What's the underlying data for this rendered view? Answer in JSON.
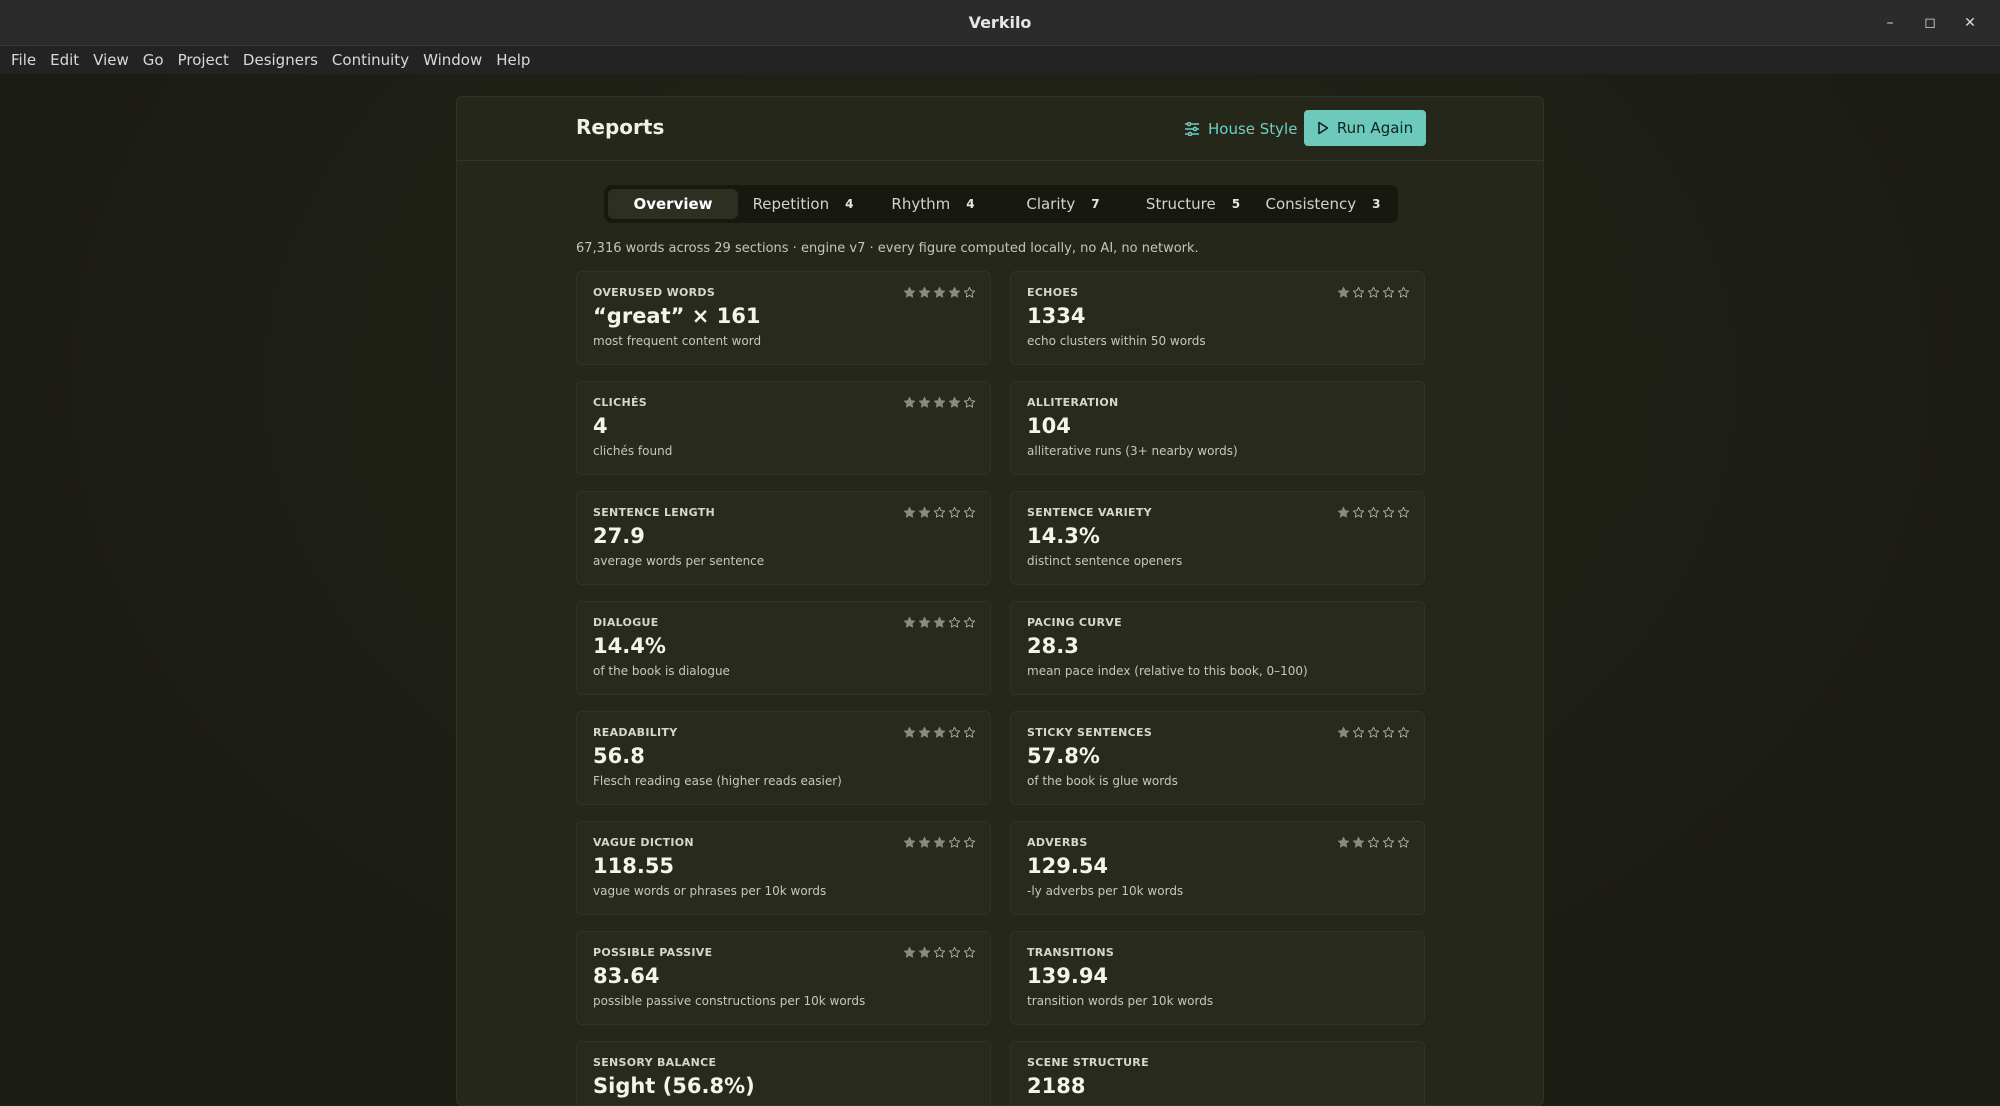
{
  "window": {
    "title": "Verkilo",
    "minimize": "–",
    "maximize": "◻",
    "close": "✕"
  },
  "menu": [
    "File",
    "Edit",
    "View",
    "Go",
    "Project",
    "Designers",
    "Continuity",
    "Window",
    "Help"
  ],
  "panel": {
    "title": "Reports",
    "house_style_label": "House Style",
    "run_again_label": "Run Again",
    "accent": "#6cc9bc"
  },
  "tabs": [
    {
      "label": "Overview",
      "count": "",
      "active": true
    },
    {
      "label": "Repetition",
      "count": "4",
      "active": false
    },
    {
      "label": "Rhythm",
      "count": "4",
      "active": false
    },
    {
      "label": "Clarity",
      "count": "7",
      "active": false
    },
    {
      "label": "Structure",
      "count": "5",
      "active": false
    },
    {
      "label": "Consistency",
      "count": "3",
      "active": false
    }
  ],
  "summary": "67,316 words across 29 sections · engine v7 · every figure computed locally, no AI, no network.",
  "cards": [
    {
      "label": "OVERUSED WORDS",
      "value": "“great” × 161",
      "desc": "most frequent content word",
      "rating": 4
    },
    {
      "label": "ECHOES",
      "value": "1334",
      "desc": "echo clusters within 50 words",
      "rating": 1
    },
    {
      "label": "CLICHÉS",
      "value": "4",
      "desc": "clichés found",
      "rating": 4
    },
    {
      "label": "ALLITERATION",
      "value": "104",
      "desc": "alliterative runs (3+ nearby words)",
      "rating": null
    },
    {
      "label": "SENTENCE LENGTH",
      "value": "27.9",
      "desc": "average words per sentence",
      "rating": 2
    },
    {
      "label": "SENTENCE VARIETY",
      "value": "14.3%",
      "desc": "distinct sentence openers",
      "rating": 1
    },
    {
      "label": "DIALOGUE",
      "value": "14.4%",
      "desc": "of the book is dialogue",
      "rating": 3
    },
    {
      "label": "PACING CURVE",
      "value": "28.3",
      "desc": "mean pace index (relative to this book, 0–100)",
      "rating": null
    },
    {
      "label": "READABILITY",
      "value": "56.8",
      "desc": "Flesch reading ease (higher reads easier)",
      "rating": 3
    },
    {
      "label": "STICKY SENTENCES",
      "value": "57.8%",
      "desc": "of the book is glue words",
      "rating": 1
    },
    {
      "label": "VAGUE DICTION",
      "value": "118.55",
      "desc": "vague words or phrases per 10k words",
      "rating": 3
    },
    {
      "label": "ADVERBS",
      "value": "129.54",
      "desc": "-ly adverbs per 10k words",
      "rating": 2
    },
    {
      "label": "POSSIBLE PASSIVE",
      "value": "83.64",
      "desc": "possible passive constructions per 10k words",
      "rating": 2
    },
    {
      "label": "TRANSITIONS",
      "value": "139.94",
      "desc": "transition words per 10k words",
      "rating": null
    },
    {
      "label": "SENSORY BALANCE",
      "value": "Sight (56.8%)",
      "desc": "",
      "rating": null
    },
    {
      "label": "SCENE STRUCTURE",
      "value": "2188",
      "desc": "",
      "rating": null
    }
  ]
}
